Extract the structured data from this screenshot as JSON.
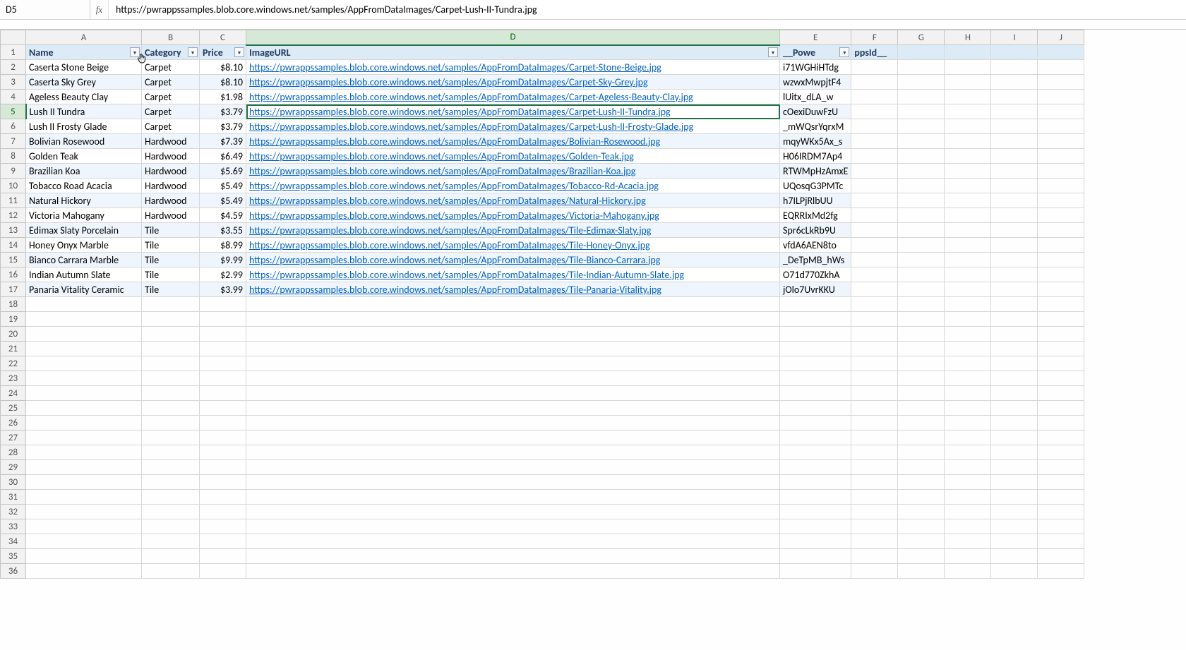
{
  "nameBox": "D5",
  "fxLabel": "fx",
  "formula": "https://pwrappssamples.blob.core.windows.net/samples/AppFromDataImages/Carpet-Lush-II-Tundra.jpg",
  "columns": [
    "A",
    "B",
    "C",
    "D",
    "E",
    "F",
    "G",
    "H",
    "I",
    "J"
  ],
  "activeCol": "D",
  "activeRow": 5,
  "tableHeaders": {
    "A": "Name",
    "B": "Category",
    "C": "Price",
    "D": "ImageURL",
    "E": "__Powe",
    "F": "ppsId__"
  },
  "rows": [
    {
      "r": 2,
      "name": "Caserta Stone Beige",
      "cat": "Carpet",
      "price": "$8.10",
      "url": "https://pwrappssamples.blob.core.windows.net/samples/AppFromDataImages/Carpet-Stone-Beige.jpg",
      "id": "i71WGHiHTdg"
    },
    {
      "r": 3,
      "name": "Caserta Sky Grey",
      "cat": "Carpet",
      "price": "$8.10",
      "url": "https://pwrappssamples.blob.core.windows.net/samples/AppFromDataImages/Carpet-Sky-Grey.jpg",
      "id": "wzwxMwpjtF4"
    },
    {
      "r": 4,
      "name": "Ageless Beauty Clay",
      "cat": "Carpet",
      "price": "$1.98",
      "url": "https://pwrappssamples.blob.core.windows.net/samples/AppFromDataImages/Carpet-Ageless-Beauty-Clay.jpg",
      "id": "lUitx_dLA_w"
    },
    {
      "r": 5,
      "name": "Lush II Tundra",
      "cat": "Carpet",
      "price": "$3.79",
      "url": "https://pwrappssamples.blob.core.windows.net/samples/AppFromDataImages/Carpet-Lush-II-Tundra.jpg",
      "id": "cOexiDuwFzU"
    },
    {
      "r": 6,
      "name": "Lush II Frosty Glade",
      "cat": "Carpet",
      "price": "$3.79",
      "url": "https://pwrappssamples.blob.core.windows.net/samples/AppFromDataImages/Carpet-Lush-II-Frosty-Glade.jpg",
      "id": "_mWQsrYqrxM"
    },
    {
      "r": 7,
      "name": "Bolivian Rosewood",
      "cat": "Hardwood",
      "price": "$7.39",
      "url": "https://pwrappssamples.blob.core.windows.net/samples/AppFromDataImages/Bolivian-Rosewood.jpg",
      "id": "mqyWKx5Ax_s"
    },
    {
      "r": 8,
      "name": "Golden Teak",
      "cat": "Hardwood",
      "price": "$6.49",
      "url": "https://pwrappssamples.blob.core.windows.net/samples/AppFromDataImages/Golden-Teak.jpg",
      "id": "H06IRDM7Ap4"
    },
    {
      "r": 9,
      "name": "Brazilian Koa",
      "cat": "Hardwood",
      "price": "$5.69",
      "url": "https://pwrappssamples.blob.core.windows.net/samples/AppFromDataImages/Brazilian-Koa.jpg",
      "id": "RTWMpHzAmxE"
    },
    {
      "r": 10,
      "name": "Tobacco Road Acacia",
      "cat": "Hardwood",
      "price": "$5.49",
      "url": "https://pwrappssamples.blob.core.windows.net/samples/AppFromDataImages/Tobacco-Rd-Acacia.jpg",
      "id": "UQosqG3PMTc"
    },
    {
      "r": 11,
      "name": "Natural Hickory",
      "cat": "Hardwood",
      "price": "$5.49",
      "url": "https://pwrappssamples.blob.core.windows.net/samples/AppFromDataImages/Natural-Hickory.jpg",
      "id": "h7ILPjRlbUU"
    },
    {
      "r": 12,
      "name": "Victoria Mahogany",
      "cat": "Hardwood",
      "price": "$4.59",
      "url": "https://pwrappssamples.blob.core.windows.net/samples/AppFromDataImages/Victoria-Mahogany.jpg",
      "id": "EQRRIxMd2fg"
    },
    {
      "r": 13,
      "name": "Edimax Slaty Porcelain",
      "cat": "Tile",
      "price": "$3.55",
      "url": "https://pwrappssamples.blob.core.windows.net/samples/AppFromDataImages/Tile-Edimax-Slaty.jpg",
      "id": "Spr6cLkRb9U"
    },
    {
      "r": 14,
      "name": "Honey Onyx Marble",
      "cat": "Tile",
      "price": "$8.99",
      "url": "https://pwrappssamples.blob.core.windows.net/samples/AppFromDataImages/Tile-Honey-Onyx.jpg",
      "id": "vfdA6AEN8to"
    },
    {
      "r": 15,
      "name": "Bianco Carrara Marble",
      "cat": "Tile",
      "price": "$9.99",
      "url": "https://pwrappssamples.blob.core.windows.net/samples/AppFromDataImages/Tile-Bianco-Carrara.jpg",
      "id": "_DeTpMB_hWs"
    },
    {
      "r": 16,
      "name": "Indian Autumn Slate",
      "cat": "Tile",
      "price": "$2.99",
      "url": "https://pwrappssamples.blob.core.windows.net/samples/AppFromDataImages/Tile-Indian-Autumn-Slate.jpg",
      "id": "O71d770ZkhA"
    },
    {
      "r": 17,
      "name": "Panaria Vitality Ceramic",
      "cat": "Tile",
      "price": "$3.99",
      "url": "https://pwrappssamples.blob.core.windows.net/samples/AppFromDataImages/Tile-Panaria-Vitality.jpg",
      "id": "jOlo7UvrKKU"
    }
  ],
  "emptyRowsFrom": 18,
  "emptyRowsTo": 36
}
